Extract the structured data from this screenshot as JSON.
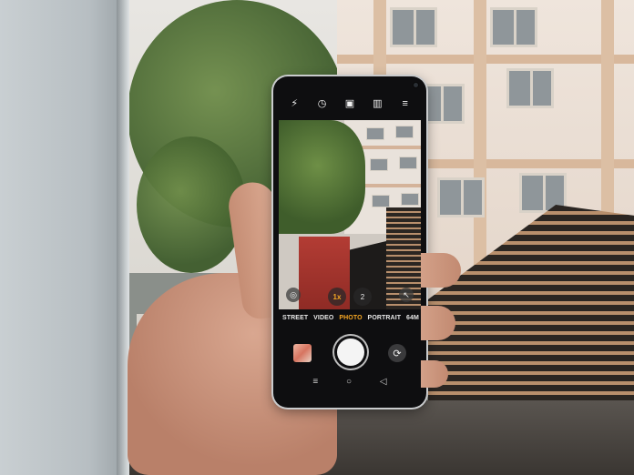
{
  "photo": {
    "description_icon": "camera-app-photo",
    "phone": {
      "top_icons": [
        "flash-off-icon",
        "timer-icon",
        "ai-scene-icon",
        "filter-icon",
        "settings-icon"
      ],
      "top_glyphs": [
        "⚡",
        "◷",
        "▣",
        "▥",
        "≡"
      ],
      "zoom": {
        "active": "1x",
        "other": "2"
      },
      "modes": [
        {
          "label": "STREET",
          "active": false
        },
        {
          "label": "VIDEO",
          "active": false
        },
        {
          "label": "PHOTO",
          "active": true
        },
        {
          "label": "PORTRAIT",
          "active": false
        },
        {
          "label": "64M",
          "active": false
        }
      ],
      "nav_glyphs": [
        "≡",
        "○",
        "◁"
      ],
      "switch_glyph": "⟳",
      "vf_left_glyph": "◎",
      "vf_right_glyph": "↖"
    },
    "colors": {
      "accent": "#f5a623",
      "phone_body": "#0e0e10"
    }
  }
}
